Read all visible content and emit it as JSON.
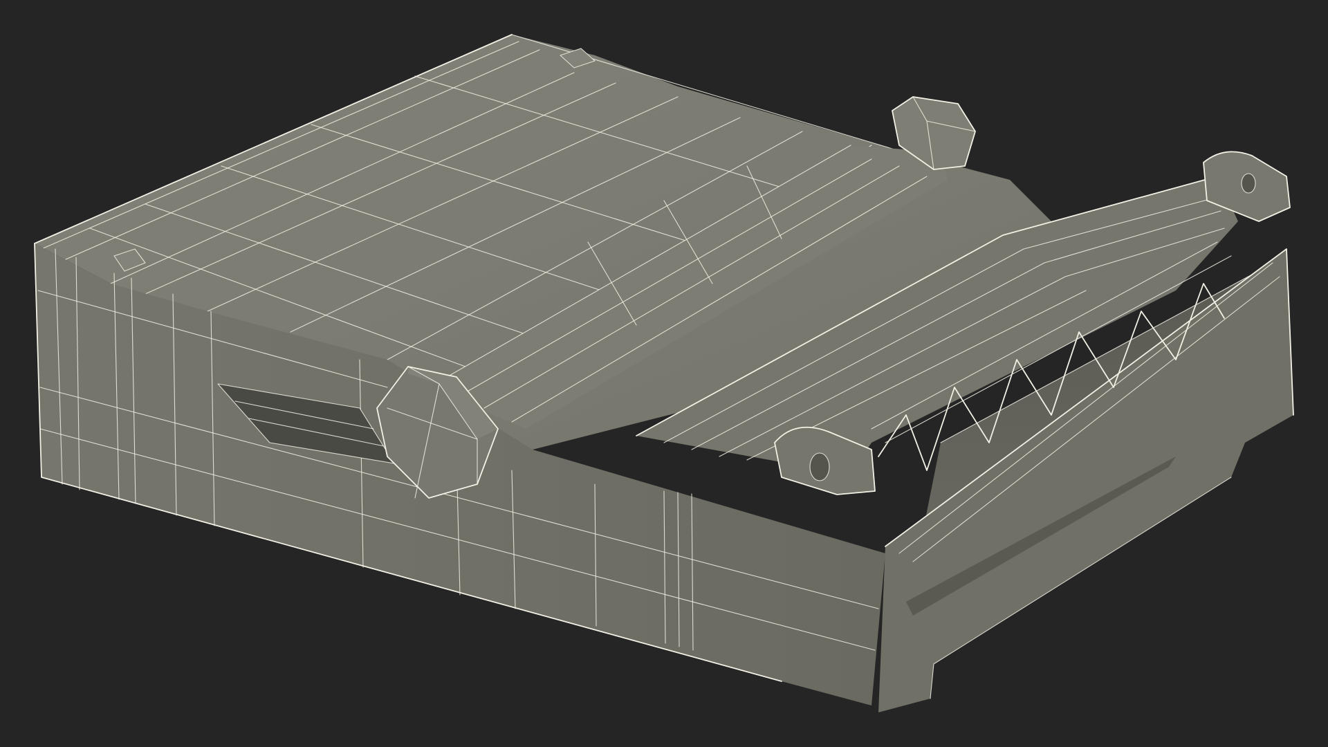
{
  "render": {
    "subject": "wireframe-3d-model",
    "colors": {
      "background": "#252525",
      "surface_top": "#7b7b71",
      "surface_side": "#6d6d64",
      "surface_inner": "#5d5d55",
      "surface_shadow": "#4a4a44",
      "wire": "#f3f1e6"
    }
  }
}
